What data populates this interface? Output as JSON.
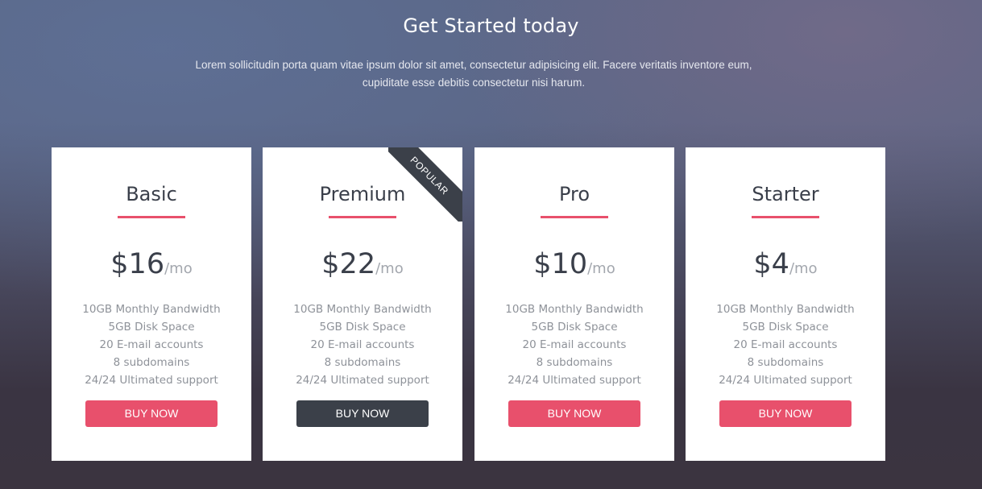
{
  "header": {
    "title": "Get Started today",
    "subtitle": "Lorem sollicitudin porta quam vitae ipsum dolor sit amet, consectetur adipisicing elit. Facere veritatis inventore eum, cupiditate esse debitis consectetur nisi harum."
  },
  "colors": {
    "accent": "#e8506c",
    "dark": "#3b4049"
  },
  "plans": [
    {
      "name": "Basic",
      "price": "$16",
      "period": "/mo",
      "features": [
        "10GB Monthly Bandwidth",
        "5GB Disk Space",
        "20 E-mail accounts",
        "8 subdomains",
        "24/24 Ultimated support"
      ],
      "button": "BUY NOW"
    },
    {
      "name": "Premium",
      "price": "$22",
      "period": "/mo",
      "badge": "POPULAR",
      "features": [
        "10GB Monthly Bandwidth",
        "5GB Disk Space",
        "20 E-mail accounts",
        "8 subdomains",
        "24/24 Ultimated support"
      ],
      "button": "BUY NOW"
    },
    {
      "name": "Pro",
      "price": "$10",
      "period": "/mo",
      "features": [
        "10GB Monthly Bandwidth",
        "5GB Disk Space",
        "20 E-mail accounts",
        "8 subdomains",
        "24/24 Ultimated support"
      ],
      "button": "BUY NOW"
    },
    {
      "name": "Starter",
      "price": "$4",
      "period": "/mo",
      "features": [
        "10GB Monthly Bandwidth",
        "5GB Disk Space",
        "20 E-mail accounts",
        "8 subdomains",
        "24/24 Ultimated support"
      ],
      "button": "BUY NOW"
    }
  ]
}
